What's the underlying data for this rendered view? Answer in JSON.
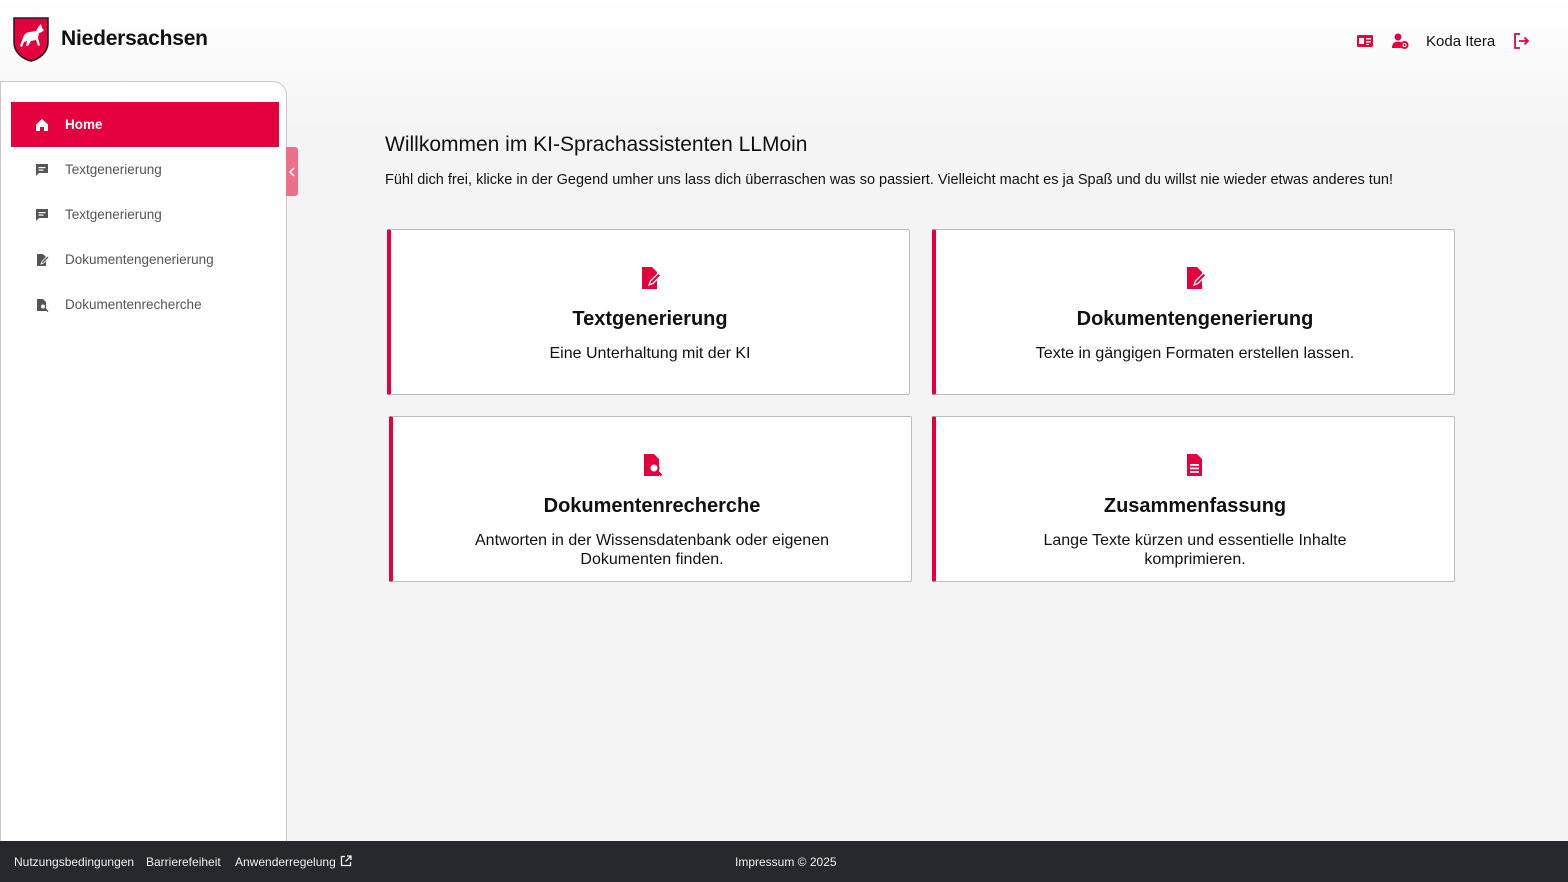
{
  "header": {
    "brand": "Niedersachsen",
    "user_name": "Koda Itera",
    "icons": [
      "id-card-icon",
      "user-gear-icon",
      "logout-icon"
    ]
  },
  "sidebar": {
    "items": [
      {
        "label": "Home",
        "icon": "home-icon",
        "active": true
      },
      {
        "label": "Textgenerierung",
        "icon": "chat-icon",
        "active": false
      },
      {
        "label": "Textgenerierung",
        "icon": "chat-icon",
        "active": false
      },
      {
        "label": "Dokumentengenerierung",
        "icon": "document-edit-icon",
        "active": false
      },
      {
        "label": "Dokumentenrecherche",
        "icon": "document-search-icon",
        "active": false
      }
    ]
  },
  "main": {
    "title": "Willkommen im KI-Sprachassistenten LLMoin",
    "intro": "Fühl dich frei, klicke in der Gegend umher uns lass dich überraschen was so passiert. Vielleicht macht es ja Spaß und du willst nie wieder etwas anderes tun!",
    "cards": [
      {
        "title": "Textgenerierung",
        "description": "Eine Unterhaltung mit der KI",
        "icon": "document-edit-icon"
      },
      {
        "title": "Dokumentengenerierung",
        "description": "Texte in gängigen Formaten erstellen lassen.",
        "icon": "document-edit-icon"
      },
      {
        "title": "Dokumentenrecherche",
        "description": "Antworten in der Wissensdatenbank oder eigenen Dokumenten finden.",
        "icon": "document-search-icon"
      },
      {
        "title": "Zusammenfassung",
        "description": "Lange Texte kürzen und essentielle Inhalte komprimieren.",
        "icon": "document-text-icon"
      }
    ]
  },
  "footer": {
    "links": [
      "Nutzungsbedingungen",
      "Barrierefeiheit",
      "Anwenderregelung"
    ],
    "copyright": "Impressum © 2025"
  },
  "colors": {
    "accent": "#e3003d",
    "collapse_tab": "#ec6f8c",
    "footer_bg": "#27282c"
  }
}
